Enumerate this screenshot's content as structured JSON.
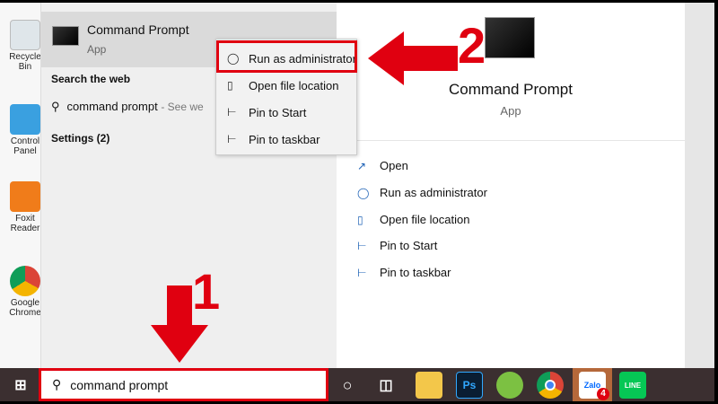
{
  "desktop": {
    "icons": [
      {
        "label": "Recycle Bin"
      },
      {
        "label": "Control Panel"
      },
      {
        "label": "Foxit Reader"
      },
      {
        "label": "Google Chrome"
      }
    ]
  },
  "results": {
    "best_match": {
      "title": "Command Prompt",
      "subtitle": "App"
    },
    "web_header": "Search the web",
    "web_query": "command prompt",
    "web_suffix": "- See we",
    "settings": "Settings (2)"
  },
  "context_menu": {
    "items": [
      {
        "label": "Run as administrator",
        "icon": "shield-icon"
      },
      {
        "label": "Open file location",
        "icon": "folder-icon"
      },
      {
        "label": "Pin to Start",
        "icon": "pin-icon"
      },
      {
        "label": "Pin to taskbar",
        "icon": "pin-icon"
      }
    ]
  },
  "detail": {
    "title": "Command Prompt",
    "subtitle": "App",
    "actions": [
      {
        "label": "Open",
        "icon": "open-icon"
      },
      {
        "label": "Run as administrator",
        "icon": "shield-icon"
      },
      {
        "label": "Open file location",
        "icon": "folder-icon"
      },
      {
        "label": "Pin to Start",
        "icon": "pin-icon"
      },
      {
        "label": "Pin to taskbar",
        "icon": "pin-icon"
      }
    ]
  },
  "taskbar": {
    "search_value": "command prompt",
    "zalo_badge": "4",
    "ps_label": "Ps",
    "line_label": "LINE"
  },
  "annotations": {
    "step1": "1",
    "step2": "2",
    "color": "#e00010"
  }
}
